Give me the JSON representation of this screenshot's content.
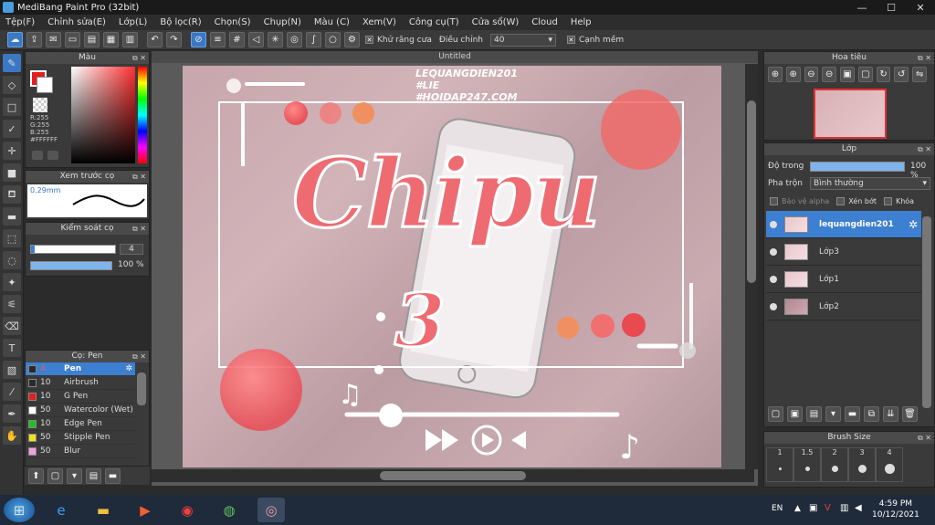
{
  "window": {
    "title": "MediBang Paint Pro (32bit)"
  },
  "menu": [
    "Tệp(F)",
    "Chỉnh sửa(E)",
    "Lớp(L)",
    "Bộ lọc(R)",
    "Chọn(S)",
    "Chụp(N)",
    "Màu (C)",
    "Xem(V)",
    "Công cụ(T)",
    "Cửa sổ(W)",
    "Cloud",
    "Help"
  ],
  "toolbar": {
    "antialias_label": "Khử răng cưa",
    "adjust_label": "Điều chỉnh",
    "adjust_value": "40",
    "edge_label": "Cạnh mềm"
  },
  "color_panel": {
    "title": "Màu",
    "r": "R:255",
    "g": "G:255",
    "b": "B:255",
    "hex": "#FFFFFF"
  },
  "preview_panel": {
    "title": "Xem trước cọ",
    "size": "0.29mm"
  },
  "control_panel": {
    "title": "Kiểm soát cọ",
    "size_value": "4",
    "opacity_value": "100 %"
  },
  "brush_panel": {
    "title": "Cọ: Pen",
    "items": [
      {
        "size": "4",
        "name": "Pen",
        "color": "#2a2a2a"
      },
      {
        "size": "10",
        "name": "Airbrush",
        "color": "#2a2a2a"
      },
      {
        "size": "10",
        "name": "G Pen",
        "color": "#e02020"
      },
      {
        "size": "50",
        "name": "Watercolor (Wet)",
        "color": "#ffffff"
      },
      {
        "size": "10",
        "name": "Edge Pen",
        "color": "#20c020"
      },
      {
        "size": "50",
        "name": "Stipple Pen",
        "color": "#f0e020"
      },
      {
        "size": "50",
        "name": "Blur",
        "color": "#f0a0e0"
      }
    ]
  },
  "canvas": {
    "title": "Untitled",
    "watermark": [
      "LEQUANGDIEN201",
      "#LIE",
      "#HOIDAP247.COM"
    ],
    "art_title": "Chipu",
    "art_number": "3"
  },
  "navigator": {
    "title": "Hoa tiêu"
  },
  "layer_panel": {
    "title": "Lớp",
    "opacity_label": "Độ trong",
    "opacity_value": "100 %",
    "blend_label": "Pha trộn",
    "blend_value": "Bình thường",
    "protect_alpha": "Bảo vệ alpha",
    "clip": "Xén bớt",
    "lock": "Khóa",
    "layers": [
      {
        "name": "lequangdien201",
        "active": true
      },
      {
        "name": "Lớp3",
        "active": false
      },
      {
        "name": "Lớp1",
        "active": false
      },
      {
        "name": "Lớp2",
        "active": false
      }
    ]
  },
  "brush_size_panel": {
    "title": "Brush Size",
    "sizes": [
      "1",
      "1.5",
      "2",
      "3",
      "4"
    ]
  },
  "taskbar": {
    "lang": "EN",
    "time": "4:59 PM",
    "date": "10/12/2021"
  },
  "colors": {
    "accent": "#3d7fd0",
    "art_red": "#e8525a"
  }
}
